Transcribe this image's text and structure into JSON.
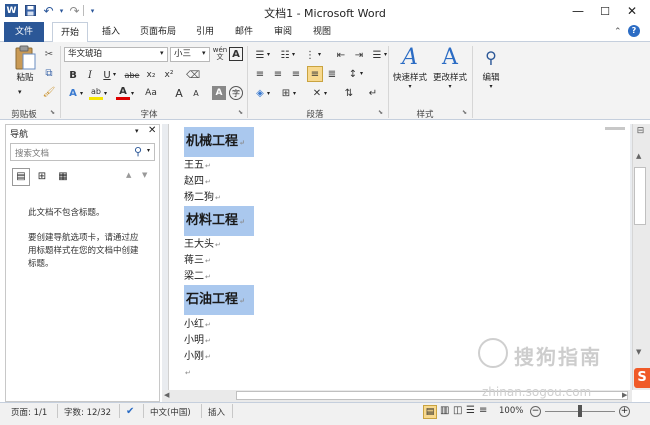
{
  "window": {
    "title": "文档1 - Microsoft Word",
    "min": "—",
    "max": "☐",
    "close": "✕"
  },
  "quick_access": {
    "word_icon": "W",
    "save": "💾",
    "undo": "↶",
    "redo": "↷",
    "customize": "▾"
  },
  "tabs": [
    {
      "label": "文件"
    },
    {
      "label": "开始"
    },
    {
      "label": "插入"
    },
    {
      "label": "页面布局"
    },
    {
      "label": "引用"
    },
    {
      "label": "邮件"
    },
    {
      "label": "审阅"
    },
    {
      "label": "视图"
    }
  ],
  "ribbon": {
    "clipboard": {
      "paste_label": "粘贴",
      "group_label": "剪贴板"
    },
    "font": {
      "font_name": "华文琥珀",
      "font_size": "小三",
      "group_label": "字体",
      "wen_label": "wén",
      "a_box": "A",
      "row2": [
        "B",
        "I",
        "U",
        "abe",
        "x₂",
        "x²"
      ],
      "row3": [
        "A",
        "ab",
        "A",
        "Aa",
        "A",
        "A",
        "A"
      ]
    },
    "paragraph": {
      "group_label": "段落"
    },
    "styles": {
      "quick_styles": "快速样式",
      "change_styles": "更改样式",
      "group_label": "样式"
    },
    "editing": {
      "label": "编辑"
    }
  },
  "nav_pane": {
    "title": "导航",
    "search_placeholder": "搜索文档",
    "message1": "此文档不包含标题。",
    "message2": "要创建导航选项卡，请通过应用标题样式在您的文档中创建标题。"
  },
  "document": {
    "sections": [
      {
        "heading": "机械工程",
        "items": [
          "王五",
          "赵四",
          "杨二狗"
        ]
      },
      {
        "heading": "材料工程",
        "items": [
          "王大头",
          "蒋三",
          "梁二"
        ]
      },
      {
        "heading": "石油工程",
        "items": [
          "小红",
          "小明",
          "小刚"
        ]
      }
    ],
    "para_mark": "↵"
  },
  "watermark": {
    "text": "搜狗指南",
    "url": "zhinan.sogou.com"
  },
  "status": {
    "page": "页面: 1/1",
    "words": "字数: 12/32",
    "language": "中文(中国)",
    "mode": "插入",
    "zoom": "100%"
  }
}
